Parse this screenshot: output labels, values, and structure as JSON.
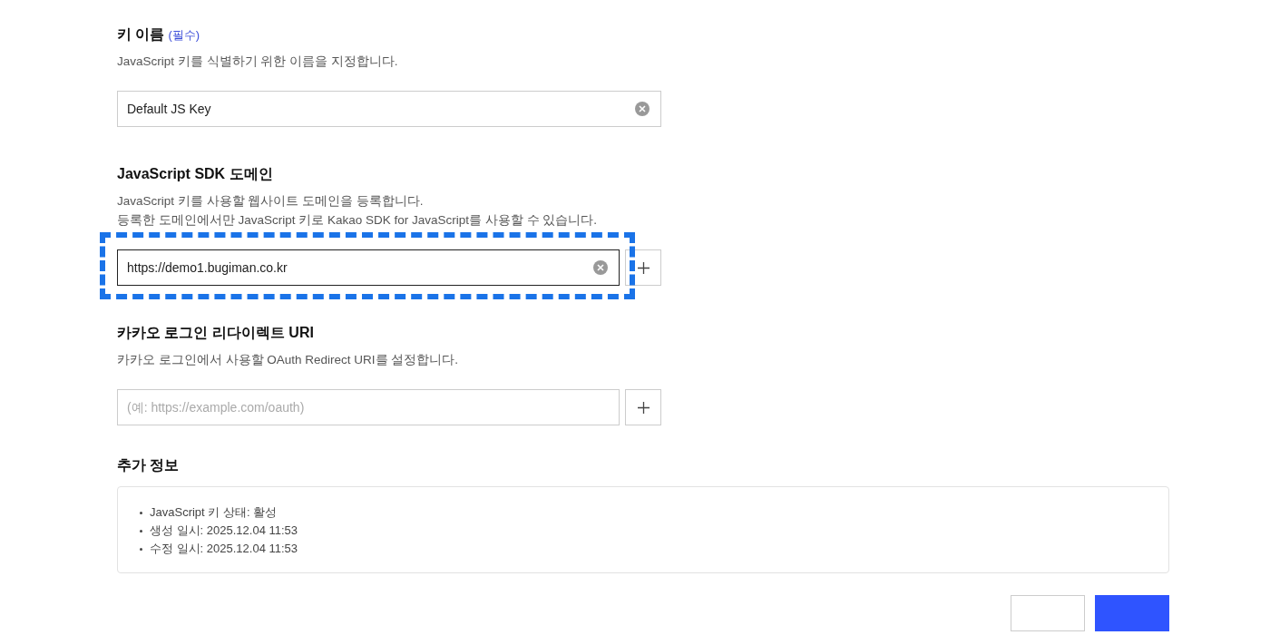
{
  "sections": [
    {
      "title": "키 이름",
      "required_label": "(필수)",
      "descriptions": [
        "JavaScript 키를 식별하기 위한 이름을 지정합니다."
      ],
      "field": {
        "value": "Default JS Key",
        "clearable": true,
        "focused": false,
        "highlighted": false,
        "add_button": false
      }
    },
    {
      "title": "JavaScript SDK 도메인",
      "descriptions": [
        "JavaScript 키를 사용할 웹사이트 도메인을 등록합니다.",
        "등록한 도메인에서만 JavaScript 키로 Kakao SDK for JavaScript를 사용할 수 있습니다."
      ],
      "field": {
        "value": "https://demo1.bugiman.co.kr",
        "clearable": true,
        "focused": true,
        "highlighted": true,
        "add_button": true
      }
    },
    {
      "title": "카카오 로그인 리다이렉트 URI",
      "descriptions": [
        "카카오 로그인에서 사용할 OAuth Redirect URI를 설정합니다."
      ],
      "field": {
        "placeholder": "(예: https://example.com/oauth)",
        "clearable": false,
        "focused": false,
        "highlighted": false,
        "add_button": true
      }
    }
  ],
  "info": {
    "title": "추가 정보",
    "items": [
      "JavaScript 키 상태: 활성",
      "생성 일시: 2025.12.04 11:53",
      "수정 일시: 2025.12.04 11:53"
    ]
  },
  "buttons": [
    {
      "kind": "secondary"
    },
    {
      "kind": "primary"
    }
  ]
}
